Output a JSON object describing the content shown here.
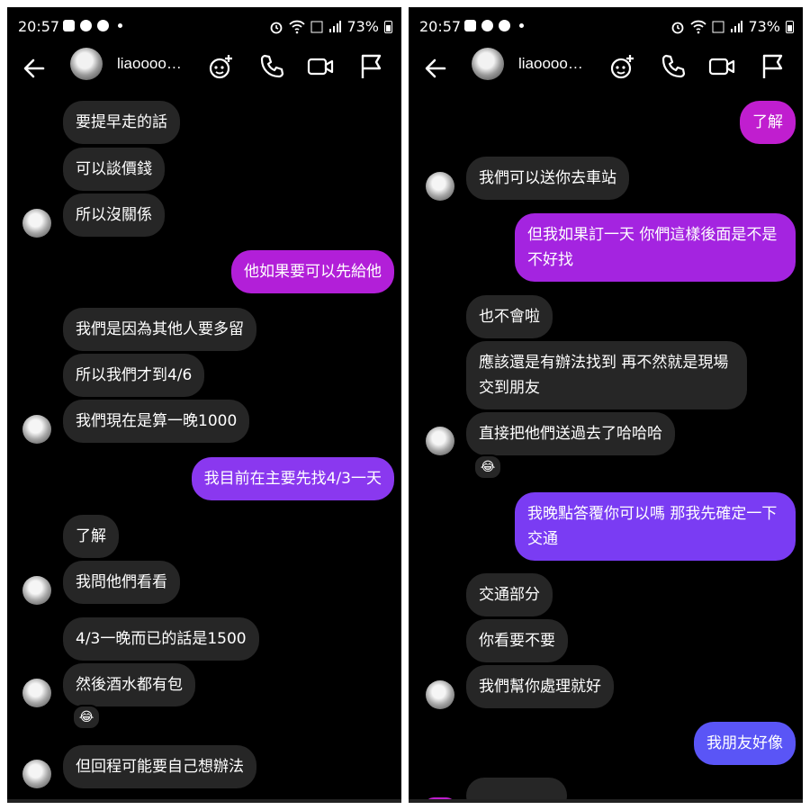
{
  "status": {
    "time": "20:57",
    "battery": "73%"
  },
  "contact": {
    "name": "liaoooo…"
  },
  "colors": {
    "bubble_received": "#262626",
    "sent_pink": "#b31fd6",
    "sent_purple": "#8a36f0",
    "sent_indigo": "#5b55f6"
  },
  "left": {
    "messages": [
      {
        "dir": "in",
        "text": "要提早走的話"
      },
      {
        "dir": "in",
        "text": "可以談價錢"
      },
      {
        "dir": "in",
        "text": "所以沒關係"
      },
      {
        "dir": "out",
        "text": "他如果要可以先給他"
      },
      {
        "dir": "in",
        "text": "我們是因為其他人要多留"
      },
      {
        "dir": "in",
        "text": "所以我們才到4/6"
      },
      {
        "dir": "in",
        "text": "我們現在是算一晚1000"
      },
      {
        "dir": "out",
        "text": "我目前在主要先找4/3一天"
      },
      {
        "dir": "in",
        "text": "了解"
      },
      {
        "dir": "in",
        "text": "我問他們看看"
      },
      {
        "dir": "in",
        "text": "4/3一晚而已的話是1500"
      },
      {
        "dir": "in",
        "text": "然後酒水都有包",
        "reaction": "😂"
      },
      {
        "dir": "in",
        "text": "但回程可能要自己想辦法"
      }
    ]
  },
  "right": {
    "messages": [
      {
        "dir": "out",
        "text": "了解"
      },
      {
        "dir": "in",
        "text": "我們可以送你去車站"
      },
      {
        "dir": "out",
        "text": "但我如果訂一天 你們這樣後面是不是\n不好找"
      },
      {
        "dir": "in",
        "text": "也不會啦"
      },
      {
        "dir": "in",
        "text": "應該還是有辦法找到 再不然就是現場\n交到朋友"
      },
      {
        "dir": "in",
        "text": "直接把他們送過去了哈哈哈",
        "reaction": "😂"
      },
      {
        "dir": "out",
        "text": "我晚點答覆你可以嗎 那我先確定一下\n交通"
      },
      {
        "dir": "in",
        "text": "交通部分"
      },
      {
        "dir": "in",
        "text": "你看要不要"
      },
      {
        "dir": "in",
        "text": "我們幫你處理就好"
      },
      {
        "dir": "out",
        "text": "我朋友好像"
      }
    ]
  }
}
